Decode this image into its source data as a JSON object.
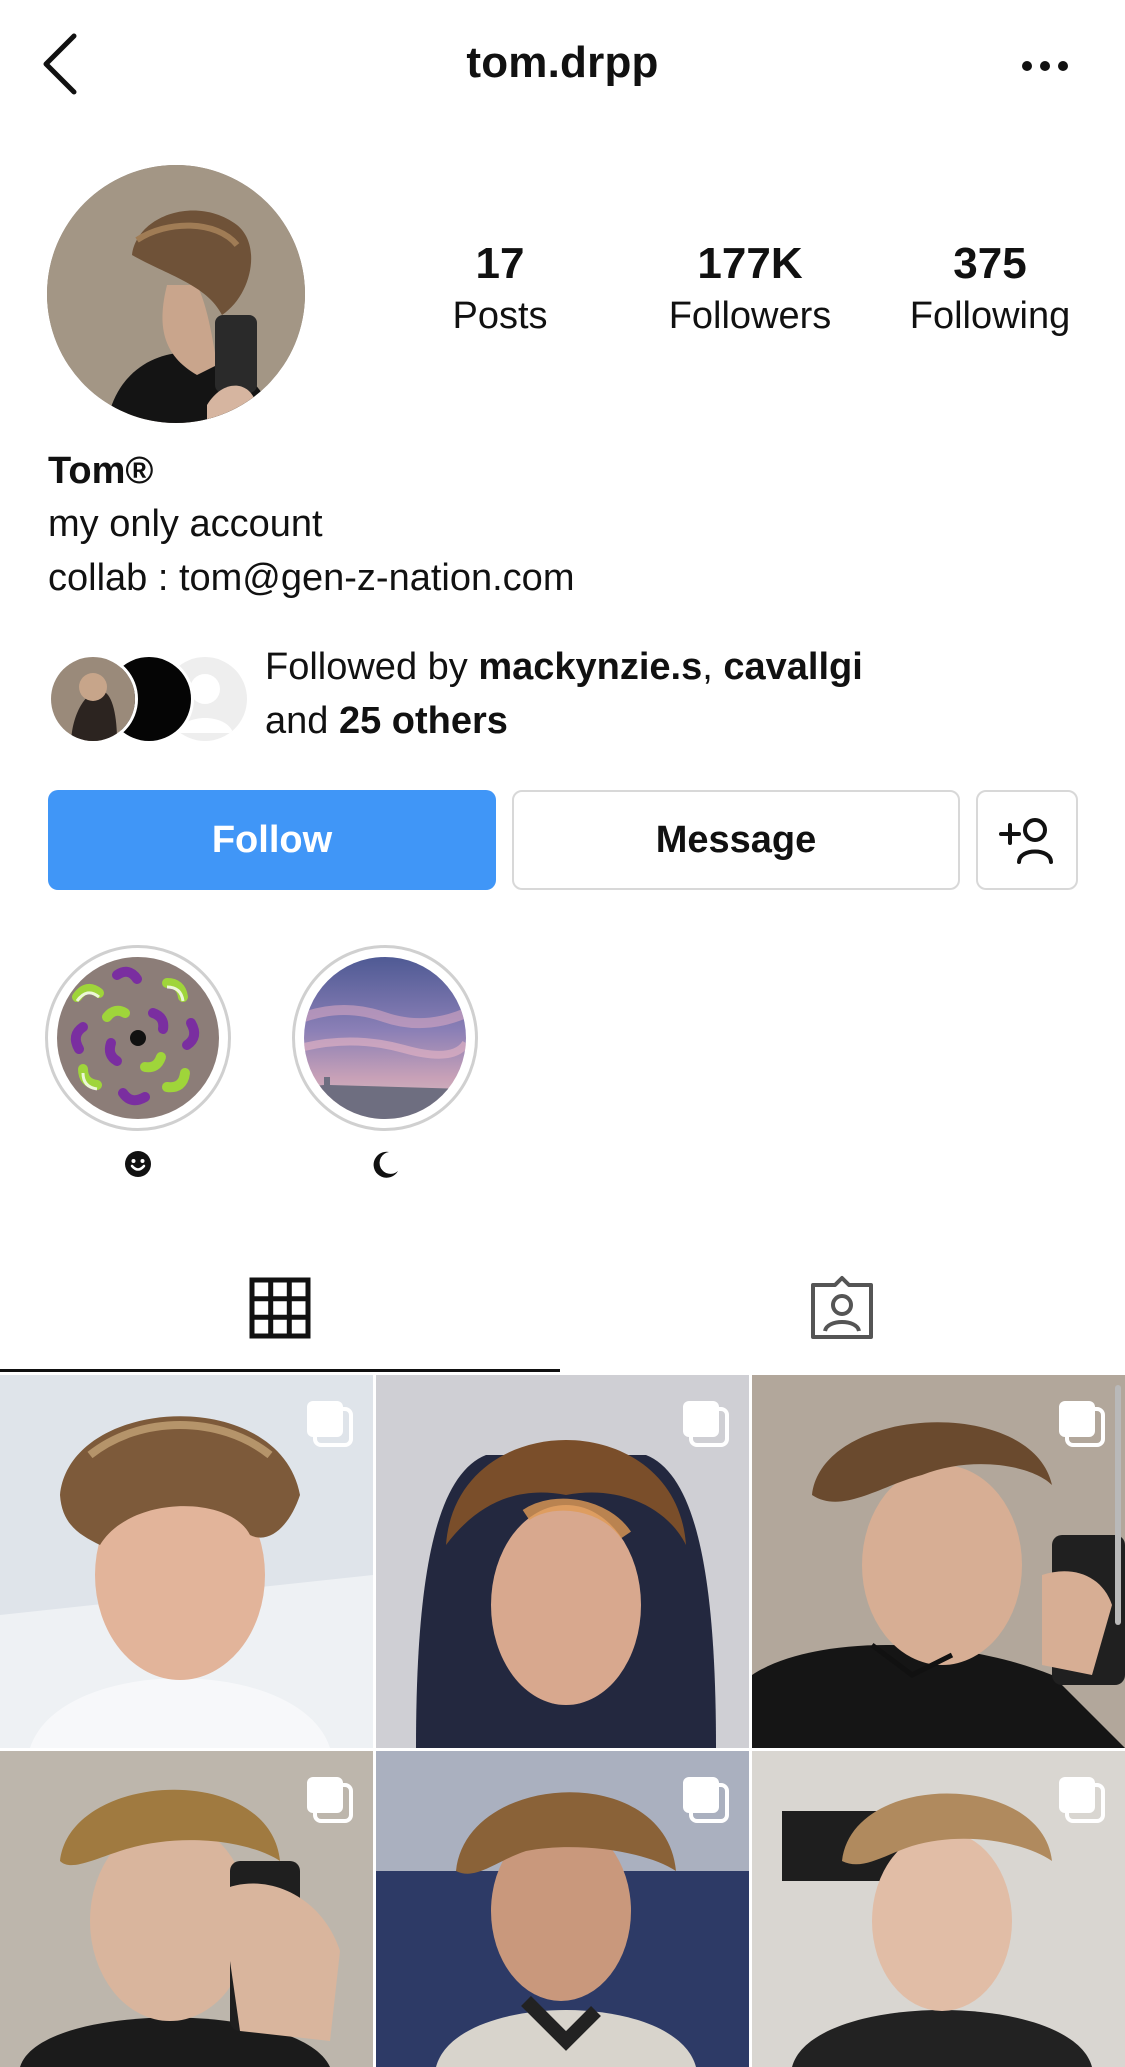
{
  "header": {
    "username": "tom.drpp",
    "back_icon": "chevron-left-icon",
    "more_icon": "ellipsis-icon"
  },
  "profile": {
    "stats": [
      {
        "value": "17",
        "label": "Posts"
      },
      {
        "value": "177K",
        "label": "Followers"
      },
      {
        "value": "375",
        "label": "Following"
      }
    ],
    "name": "Tom®",
    "bio_lines": [
      "my only account",
      "collab : tom@gen-z-nation.com"
    ],
    "followed_by": {
      "prefix": "Followed by ",
      "user1": "mackynzie.s",
      "separator": ", ",
      "user2": "cavallgi",
      "and": "and ",
      "others": "25 others"
    }
  },
  "actions": {
    "follow_label": "Follow",
    "message_label": "Message",
    "add_person_icon": "person-plus-icon"
  },
  "highlights": [
    {
      "label_icon": "smiley-icon"
    },
    {
      "label_icon": "moon-icon"
    }
  ],
  "tabs": [
    {
      "icon": "grid-icon",
      "active": true
    },
    {
      "icon": "tagged-person-icon",
      "active": false
    }
  ],
  "colors": {
    "accent": "#4096f7",
    "border": "#d8d8d8",
    "text": "#111111"
  }
}
